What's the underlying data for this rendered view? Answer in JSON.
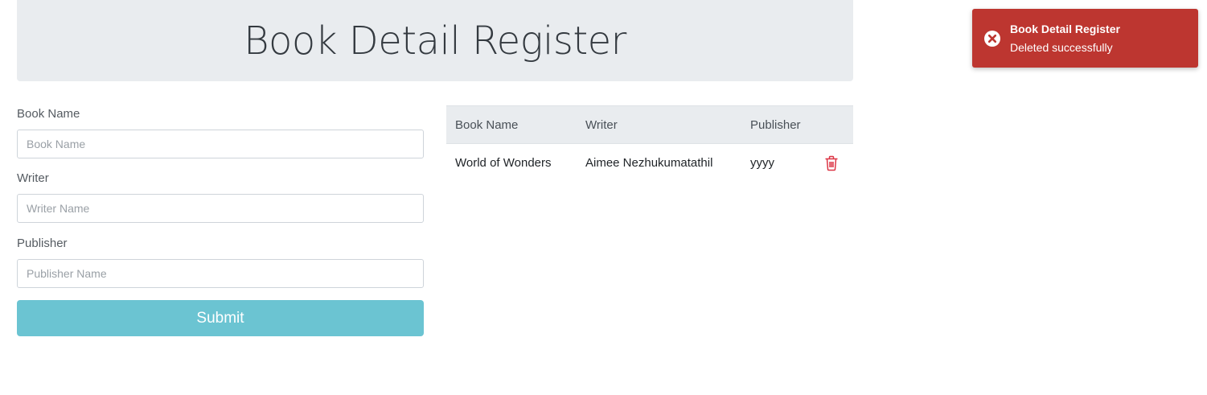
{
  "header": {
    "title": "Book Detail Register"
  },
  "form": {
    "book_name": {
      "label": "Book Name",
      "placeholder": "Book Name",
      "value": ""
    },
    "writer": {
      "label": "Writer",
      "placeholder": "Writer Name",
      "value": ""
    },
    "publisher": {
      "label": "Publisher",
      "placeholder": "Publisher Name",
      "value": ""
    },
    "submit_label": "Submit"
  },
  "table": {
    "columns": [
      "Book Name",
      "Writer",
      "Publisher"
    ],
    "rows": [
      {
        "book_name": "World of Wonders",
        "writer": "Aimee Nezhukumatathil",
        "publisher": "yyyy",
        "action_icon": "trash-icon"
      }
    ]
  },
  "toast": {
    "title": "Book Detail Register",
    "message": "Deleted successfully",
    "icon": "error-circle-icon",
    "color": "#bd3630"
  },
  "colors": {
    "submit_button": "#6bc4d2",
    "header_background": "#e9ecef",
    "delete_icon": "#dc3545"
  }
}
